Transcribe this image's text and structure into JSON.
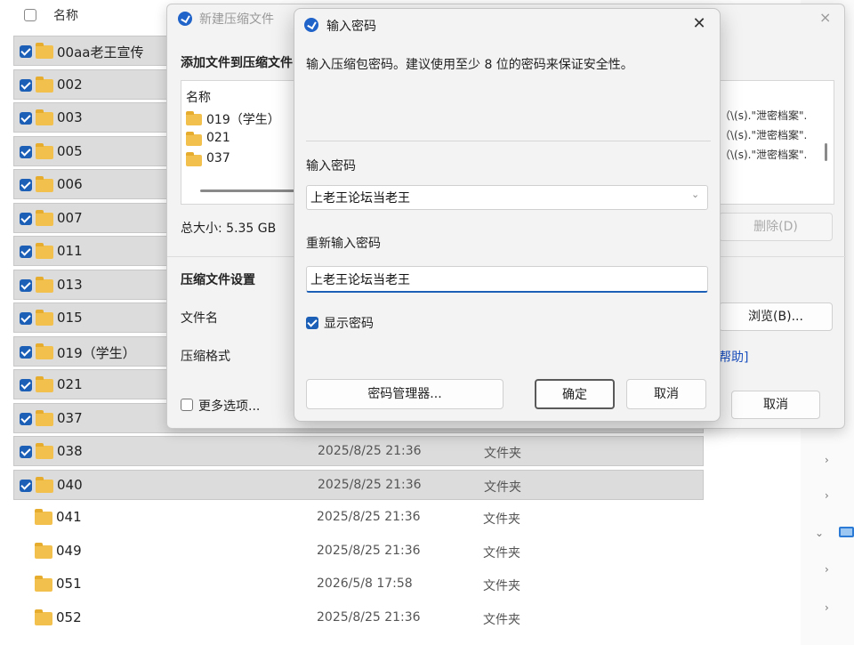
{
  "explorer": {
    "header": {
      "name_col": "名称"
    },
    "rows": [
      {
        "name": "00aa老王宣传",
        "date": "",
        "type": "",
        "selected": true
      },
      {
        "name": "002",
        "date": "",
        "type": "",
        "selected": true
      },
      {
        "name": "003",
        "date": "",
        "type": "",
        "selected": true
      },
      {
        "name": "005",
        "date": "",
        "type": "",
        "selected": true
      },
      {
        "name": "006",
        "date": "",
        "type": "",
        "selected": true
      },
      {
        "name": "007",
        "date": "",
        "type": "",
        "selected": true
      },
      {
        "name": "011",
        "date": "",
        "type": "",
        "selected": true
      },
      {
        "name": "013",
        "date": "",
        "type": "",
        "selected": true
      },
      {
        "name": "015",
        "date": "",
        "type": "",
        "selected": true
      },
      {
        "name": "019（学生）",
        "date": "",
        "type": "",
        "selected": true
      },
      {
        "name": "021",
        "date": "",
        "type": "",
        "selected": true
      },
      {
        "name": "037",
        "date": "",
        "type": "",
        "selected": true
      },
      {
        "name": "038",
        "date": "2025/8/25 21:36",
        "type": "文件夹",
        "selected": true
      },
      {
        "name": "040",
        "date": "2025/8/25 21:36",
        "type": "文件夹",
        "selected": true
      },
      {
        "name": "041",
        "date": "2025/8/25 21:36",
        "type": "文件夹",
        "selected": false
      },
      {
        "name": "049",
        "date": "2025/8/25 21:36",
        "type": "文件夹",
        "selected": false
      },
      {
        "name": "051",
        "date": "2026/5/8 17:58",
        "type": "文件夹",
        "selected": false
      },
      {
        "name": "052",
        "date": "2025/8/25 21:36",
        "type": "文件夹",
        "selected": false
      }
    ]
  },
  "compress_dialog": {
    "title": "新建压缩文件",
    "close_icon": "×",
    "add_files_label": "添加文件到压缩文件",
    "file_list": {
      "header": "名称",
      "items": [
        "019（学生）",
        "021",
        "037"
      ]
    },
    "rules": [
      "（\\(s).\"泄密档案\".",
      "（\\(s).\"泄密档案\".",
      "（\\(s).\"泄密档案\"."
    ],
    "total_size": "总大小: 5.35 GB",
    "delete_button": "删除(D)",
    "settings_label": "压缩文件设置",
    "filename_label": "文件名",
    "browse_button": "浏览(B)...",
    "format_label": "压缩格式",
    "help_link": "帮助]",
    "more_options": "更多选项...",
    "cancel_button": "取消"
  },
  "password_dialog": {
    "title": "输入密码",
    "close_icon": "✕",
    "description": "输入压缩包密码。建议使用至少 8 位的密码来保证安全性。",
    "password_label": "输入密码",
    "password_value": "上老王论坛当老王",
    "dropdown_icon": "⌄",
    "reenter_label": "重新输入密码",
    "reenter_value": "上老王论坛当老王",
    "show_password_label": "显示密码",
    "show_password_checked": true,
    "password_manager_button": "密码管理器...",
    "ok_button": "确定",
    "cancel_button": "取消"
  },
  "colors": {
    "accent": "#1c5fb7",
    "folder": "#f2c04d",
    "selection": "#dcdcdc"
  }
}
